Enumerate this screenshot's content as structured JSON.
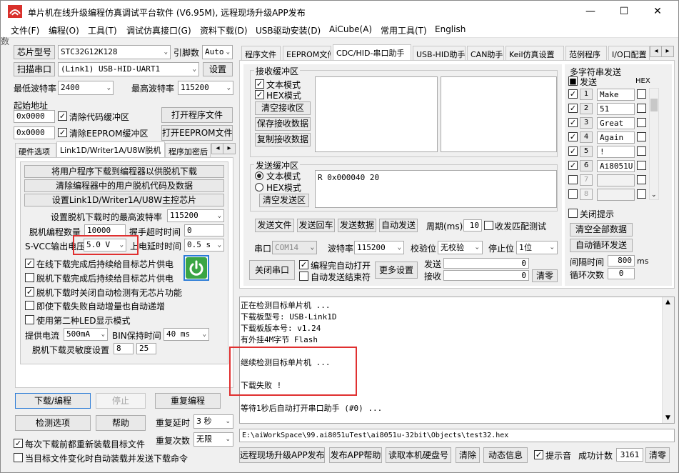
{
  "window": {
    "title": "单片机在线升级编程仿真调试平台软件 (V6.95M), 远程现场升级APP发布",
    "controls": {
      "minimize": "—",
      "maximize": "☐",
      "close": "✕"
    }
  },
  "menu": [
    "文件(F)",
    "编程(O)",
    "工具(T)",
    "调试仿真接口(G)",
    "资料下载(D)",
    "USB驱动安装(D)",
    "AiCube(A)",
    "常用工具(T)",
    "English"
  ],
  "side_char": "数",
  "left": {
    "chip_label": "芯片型号",
    "chip_value": "STC32G12K128",
    "pins_label": "引脚数",
    "pins_value": "Auto",
    "scan_label": "扫描串口",
    "port_value": "(Link1) USB-HID-UART1",
    "settings_label": "设置",
    "min_baud_label": "最低波特率",
    "min_baud_value": "2400",
    "max_baud_label": "最高波特率",
    "max_baud_value": "115200",
    "start_addr_label": "起始地址",
    "addr1": "0x0000",
    "addr2": "0x0000",
    "clear_code_label": "清除代码缓冲区",
    "clear_eeprom_label": "清除EEPROM缓冲区",
    "open_prog_label": "打开程序文件",
    "open_eeprom_label": "打开EEPROM文件",
    "tabs": [
      "硬件选项",
      "Link1D/Writer1A/U8W脱机",
      "程序加密后"
    ],
    "tab_arrows": [
      "◂",
      "▸"
    ],
    "offline": {
      "btn1": "将用户程序下载到编程器以供脱机下载",
      "btn2": "清除编程器中的用户脱机代码及数据",
      "btn3": "设置Link1D/Writer1A/U8W主控芯片",
      "max_baud_label": "设置脱机下载时的最高波特率",
      "max_baud_value": "115200",
      "count_label": "脱机编程数量",
      "count_value": "10000",
      "timeout_label": "握手超时时间",
      "timeout_value": "0",
      "svcc_label": "S-VCC输出电压",
      "svcc_value": "5.0 V",
      "delay_label": "上电延时时间",
      "delay_value": "0.5 s",
      "chk1": "在线下载完成后持续给目标芯片供电",
      "chk2": "脱机下载完成后持续给目标芯片供电",
      "chk3": "脱机下载时关闭自动检测有无芯片功能",
      "chk4": "即使下载失败自动增量也自动递增",
      "chk5": "使用第二种LED显示模式",
      "current_label": "提供电流",
      "current_value": "500mA",
      "bin_label": "BIN保持时间",
      "bin_value": "40 ms",
      "sens_label": "脱机下载灵敏度设置",
      "sens1": "8",
      "sens2": "25"
    },
    "download_label": "下载/编程",
    "stop_label": "停止",
    "redownload_label": "重复编程",
    "detect_label": "检测选项",
    "help_label": "帮助",
    "repeat_delay_label": "重复延时",
    "repeat_delay_value": "3 秒",
    "repeat_count_label": "重复次数",
    "repeat_count_value": "无限",
    "reload_label": "每次下载前都重新装载目标文件",
    "auto_load_label": "当目标文件变化时自动装载并发送下载命令"
  },
  "right": {
    "tabs": [
      "程序文件",
      "EEPROM文件",
      "CDC/HID-串口助手",
      "USB-HID助手",
      "CAN助手",
      "Keil仿真设置",
      "范例程序",
      "I/O口配置"
    ],
    "tab_arrows": [
      "◂",
      "▸"
    ],
    "recv": {
      "title": "接收缓冲区",
      "text_mode": "文本模式",
      "hex_mode": "HEX模式",
      "clear": "清空接收区",
      "save": "保存接收数据",
      "copy": "复制接收数据"
    },
    "send": {
      "title": "发送缓冲区",
      "text_mode": "文本模式",
      "hex_mode": "HEX模式",
      "clear": "清空发送区",
      "content": "R 0x000040 20"
    },
    "send_file": "发送文件",
    "send_echo": "发送回车",
    "send_data": "发送数据",
    "auto_send": "自动发送",
    "period_label": "周期(ms)",
    "period_value": "10",
    "match_label": "收发匹配测试",
    "port_label": "串口",
    "port_value": "COM14",
    "baud_label": "波特率",
    "baud_value": "115200",
    "parity_label": "校验位",
    "parity_value": "无校验",
    "stop_label": "停止位",
    "stop_value": "1位",
    "close_port": "关闭串口",
    "auto_open": "编程完自动打开",
    "auto_end": "自动发送结束符",
    "more": "更多设置",
    "sent_label": "发送",
    "sent_value": "0",
    "recv_label": "接收",
    "recv_value": "0",
    "clear_count": "清零",
    "multi": {
      "title": "多字符串发送",
      "send_col": "发送",
      "hex_col": "HEX",
      "rows": [
        {
          "n": "1",
          "text": "Make",
          "checked": true,
          "enabled": true
        },
        {
          "n": "2",
          "text": "51",
          "checked": true,
          "enabled": true
        },
        {
          "n": "3",
          "text": "Great",
          "checked": true,
          "enabled": true
        },
        {
          "n": "4",
          "text": "Again",
          "checked": true,
          "enabled": true
        },
        {
          "n": "5",
          "text": "!",
          "checked": true,
          "enabled": true
        },
        {
          "n": "6",
          "text": "Ai8051U",
          "checked": true,
          "enabled": true
        },
        {
          "n": "7",
          "text": "",
          "checked": false,
          "enabled": false
        },
        {
          "n": "8",
          "text": "",
          "checked": false,
          "enabled": false
        }
      ],
      "close_tip": "关闭提示",
      "clear_all": "清空全部数据",
      "auto_loop": "自动循环发送",
      "interval_label": "间隔时间",
      "interval_value": "800",
      "interval_unit": "ms",
      "loop_label": "循环次数",
      "loop_value": "0"
    },
    "log": [
      "正在检测目标单片机 ...",
      "  下载板型号: USB-Link1D",
      "  下载板版本号: v1.24",
      "  有外挂4M字节 Flash",
      "",
      "继续检测目标单片机 ...",
      "",
      "下载失败 !",
      "",
      "等待1秒后自动打开串口助手 (#0) ..."
    ],
    "path": "E:\\aiWorkSpace\\99.ai8051uTest\\ai8051u-32bit\\Objects\\test32.hex",
    "publish_app": "远程现场升级APP发布",
    "publish_help": "发布APP帮助",
    "read_disk": "读取本机硬盘号",
    "clear": "清除",
    "anim": "动态信息",
    "sound": "提示音",
    "success_label": "成功计数",
    "success_value": "3161",
    "clear_success": "清零"
  },
  "colors": {
    "red_highlight": "#e03030",
    "power_green": "#3aa544",
    "blue_border": "#2b7bd6"
  }
}
